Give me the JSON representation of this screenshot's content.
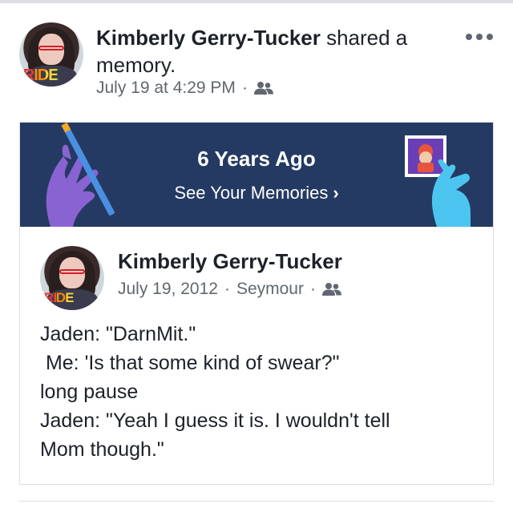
{
  "post": {
    "author": "Kimberly Gerry-Tucker",
    "action": " shared a memory.",
    "date": "July 19 at 4:29 PM",
    "separator": "·",
    "audience_icon": "friends-icon",
    "more_icon": "more-options-icon",
    "avatar_badge": "RIDE"
  },
  "memory_card": {
    "title": "6 Years Ago",
    "link_label": "See Your Memories",
    "link_chevron": "›",
    "banner_color": "#243a62"
  },
  "original_post": {
    "author": "Kimberly Gerry-Tucker",
    "date": "July 19, 2012",
    "location": "Seymour",
    "separator": "·",
    "audience_icon": "friends-icon",
    "avatar_badge": "RIDE",
    "lines": [
      "Jaden: \"DarnMit.\"",
      " Me: 'Is that some kind of swear?\"",
      "long pause",
      "Jaden: \"Yeah I guess it is. I wouldn't tell",
      "Mom though.\""
    ]
  }
}
